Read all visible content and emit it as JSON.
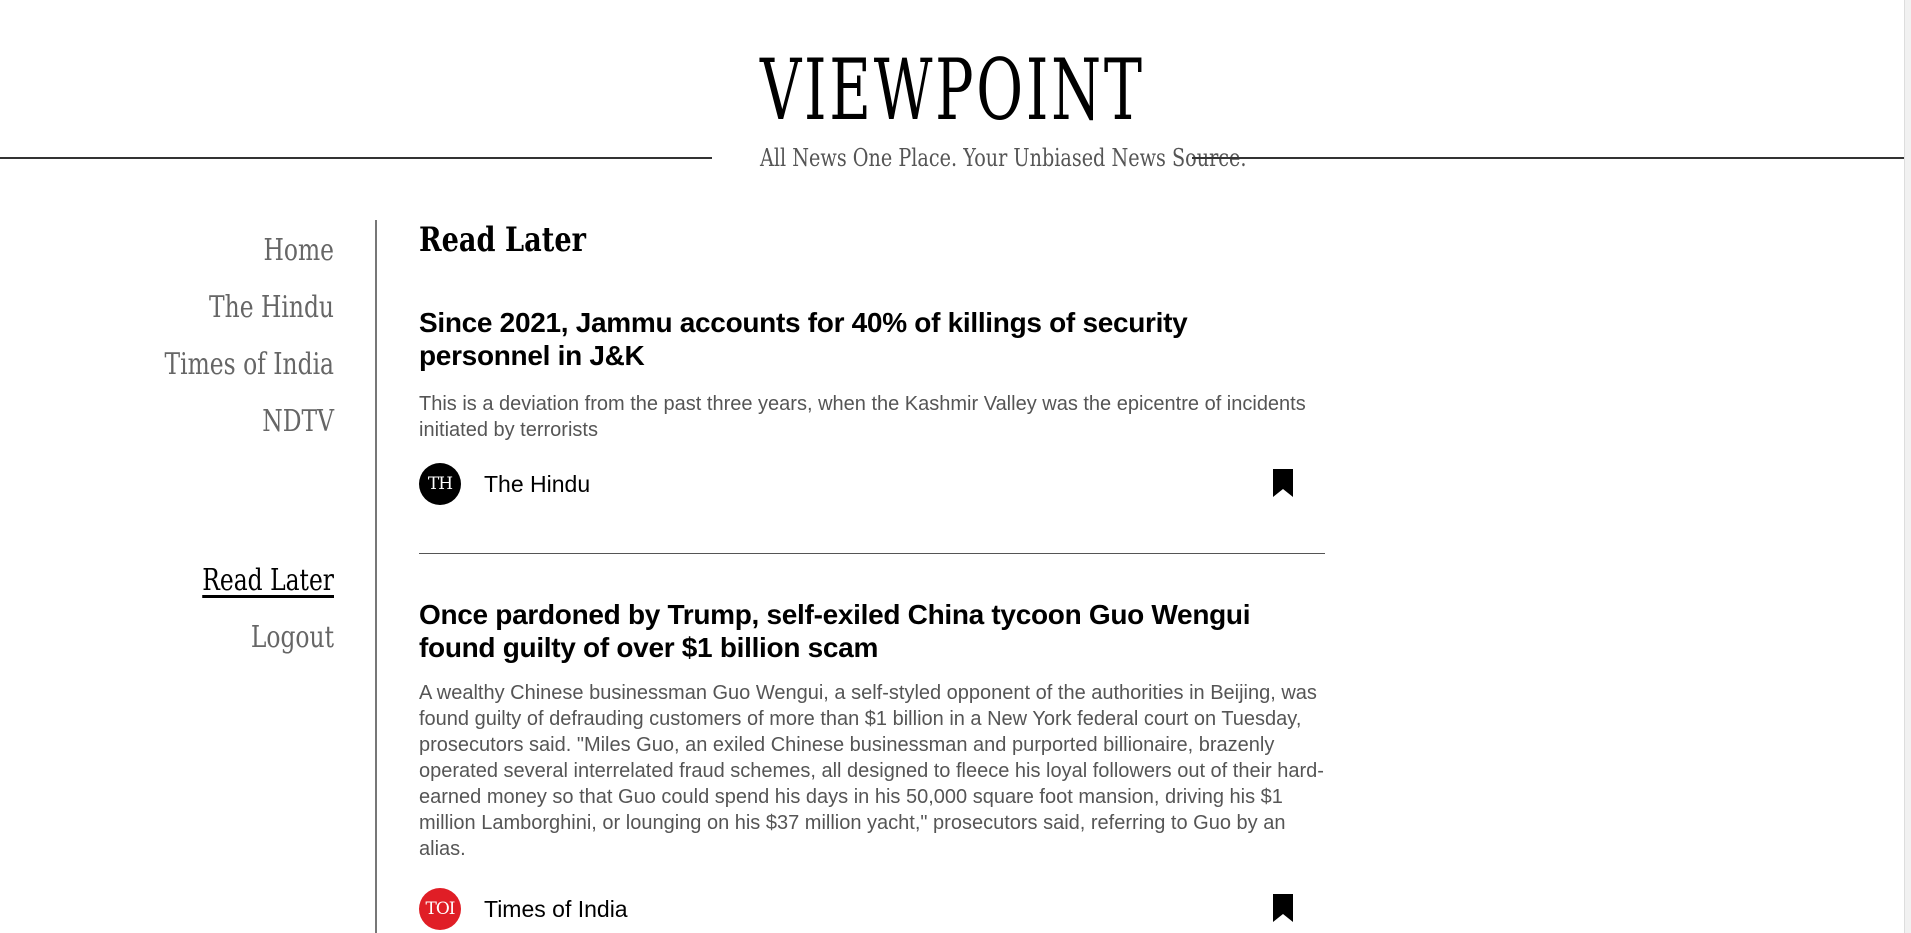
{
  "header": {
    "logo": "VIEWPOINT",
    "tagline": "All News One Place. Your Unbiased News Source."
  },
  "sidebar": {
    "items": [
      {
        "label": "Home"
      },
      {
        "label": "The Hindu"
      },
      {
        "label": "Times of India"
      },
      {
        "label": "NDTV"
      }
    ],
    "secondary": [
      {
        "label": "Read Later",
        "active": true
      },
      {
        "label": "Logout"
      }
    ]
  },
  "main": {
    "title": "Read Later",
    "articles": [
      {
        "title": "Since 2021, Jammu accounts for 40% of killings of security personnel in J&K",
        "description": "This is a deviation from the past three years, when the Kashmir Valley was the epicentre of incidents initiated by terrorists",
        "source": "The Hindu",
        "source_badge": "TH",
        "badge_color": "#000000",
        "bookmark_icon": "bookmark-filled-icon"
      },
      {
        "title": "Once pardoned by Trump, self-exiled China tycoon Guo Wengui found guilty of over $1 billion scam",
        "description": "A wealthy Chinese businessman Guo Wengui, a self-styled opponent of the authorities in Beijing, was found guilty of defrauding customers of more than $1 billion in a New York federal court on Tuesday, prosecutors said. \"Miles Guo, an exiled Chinese businessman and purported billionaire, brazenly operated several interrelated fraud schemes, all designed to fleece his loyal followers out of their hard-earned money so that Guo could spend his days in his 50,000 square foot mansion, driving his $1 million Lamborghini, or lounging on his $37 million yacht,\" prosecutors said, referring to Guo by an alias.",
        "source": "Times of India",
        "source_badge": "TOI",
        "badge_color": "#e01e26",
        "bookmark_icon": "bookmark-filled-icon"
      }
    ]
  }
}
